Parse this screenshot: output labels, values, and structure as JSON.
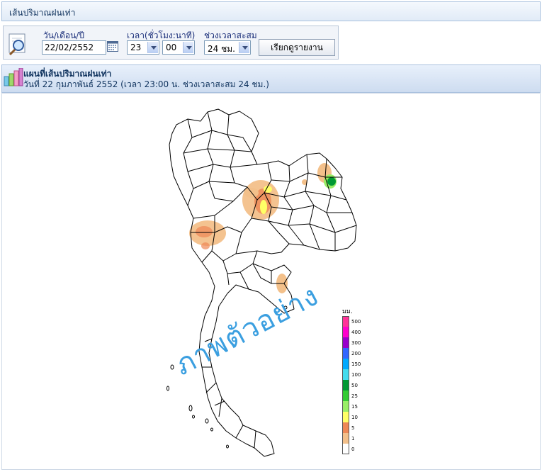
{
  "header": {
    "title": "เส้นปริมาณฝนเท่า"
  },
  "controls": {
    "date_label": "วัน/เดือน/ปี",
    "date_value": "22/02/2552",
    "time_label": "เวลา(ชั่วโมง:นาที)",
    "hour_value": "23",
    "minute_value": "00",
    "period_label": "ช่วงเวลาสะสม",
    "period_value": "24 ชม.",
    "report_button": "เรียกดูรายงาน"
  },
  "section": {
    "title": "แผนที่เส้นปริมาณฝนเท่า",
    "subtitle": "วันที่ 22 กุมภาพันธ์ 2552 (เวลา 23:00 น. ช่วงเวลาสะสม 24 ชม.)"
  },
  "map": {
    "watermark": "ภาพตัวอย่าง",
    "legend_unit": "มม.",
    "legend": [
      {
        "label": "500",
        "color": "#ff3399"
      },
      {
        "label": "400",
        "color": "#ff00cc"
      },
      {
        "label": "300",
        "color": "#9900cc"
      },
      {
        "label": "200",
        "color": "#3366ff"
      },
      {
        "label": "150",
        "color": "#00aaff"
      },
      {
        "label": "100",
        "color": "#44ddee"
      },
      {
        "label": "50",
        "color": "#009933"
      },
      {
        "label": "25",
        "color": "#33cc33"
      },
      {
        "label": "15",
        "color": "#99ee66"
      },
      {
        "label": "10",
        "color": "#ffff66"
      },
      {
        "label": "5",
        "color": "#ee8855"
      },
      {
        "label": "1",
        "color": "#f3c08a"
      },
      {
        "label": "0",
        "color": "#ffffff"
      }
    ]
  }
}
